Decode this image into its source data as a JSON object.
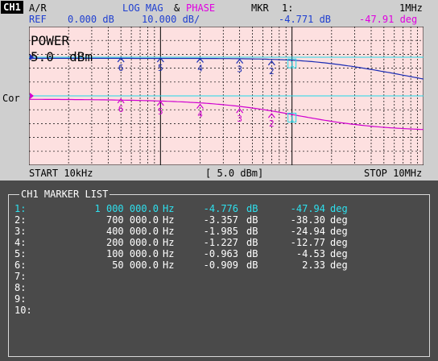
{
  "header": {
    "channel": "CH1",
    "meas": "A/R",
    "format_mag": "LOG MAG",
    "amp": "&",
    "format_phase": "PHASE",
    "mkr": "MKR",
    "mkr_num": "1:",
    "mkr_freq": "1MHz",
    "ref_label": "REF",
    "ref_value": "0.000 dB",
    "scale": "10.000 dB/",
    "mkr_mag": "-4.771 dB",
    "mkr_phase": "-47.91 deg"
  },
  "plot": {
    "power_label": "POWER",
    "power_value": "5.0  dBm",
    "side_label": "Cor",
    "start": "START 10kHz",
    "center": "[ 5.0 dBm]",
    "stop": "STOP 10MHz",
    "active_marker": "1",
    "colors": {
      "mag": "#1a2cb4",
      "phase": "#d000d0",
      "ref": "#20d8e8",
      "background": "#fde0e0"
    },
    "markers": [
      {
        "id": "1",
        "freq_hz": 1000000,
        "mag_db": -4.776,
        "phase_deg": -47.94
      },
      {
        "id": "2",
        "freq_hz": 700000,
        "mag_db": -3.357,
        "phase_deg": -38.3
      },
      {
        "id": "3",
        "freq_hz": 400000,
        "mag_db": -1.985,
        "phase_deg": -24.94
      },
      {
        "id": "4",
        "freq_hz": 200000,
        "mag_db": -1.227,
        "phase_deg": -12.77
      },
      {
        "id": "5",
        "freq_hz": 100000,
        "mag_db": -0.963,
        "phase_deg": -4.53
      },
      {
        "id": "6",
        "freq_hz": 50000,
        "mag_db": -0.909,
        "phase_deg": 2.33
      }
    ]
  },
  "marker_list": {
    "title": "CH1 MARKER LIST",
    "rows": [
      {
        "n": "1:",
        "freq": "1 000 000.0",
        "hz": "Hz",
        "db": "-4.776",
        "dbu": "dB",
        "ph": "-47.94",
        "phu": "deg"
      },
      {
        "n": "2:",
        "freq": "700 000.0",
        "hz": "Hz",
        "db": "-3.357",
        "dbu": "dB",
        "ph": "-38.30",
        "phu": "deg"
      },
      {
        "n": "3:",
        "freq": "400 000.0",
        "hz": "Hz",
        "db": "-1.985",
        "dbu": "dB",
        "ph": "-24.94",
        "phu": "deg"
      },
      {
        "n": "4:",
        "freq": "200 000.0",
        "hz": "Hz",
        "db": "-1.227",
        "dbu": "dB",
        "ph": "-12.77",
        "phu": "deg"
      },
      {
        "n": "5:",
        "freq": "100 000.0",
        "hz": "Hz",
        "db": "-0.963",
        "dbu": "dB",
        "ph": "-4.53",
        "phu": "deg"
      },
      {
        "n": "6:",
        "freq": "50 000.0",
        "hz": "Hz",
        "db": "-0.909",
        "dbu": "dB",
        "ph": "2.33",
        "phu": "deg"
      },
      {
        "n": "7:",
        "freq": "",
        "hz": "",
        "db": "",
        "dbu": "",
        "ph": "",
        "phu": ""
      },
      {
        "n": "8:",
        "freq": "",
        "hz": "",
        "db": "",
        "dbu": "",
        "ph": "",
        "phu": ""
      },
      {
        "n": "9:",
        "freq": "",
        "hz": "",
        "db": "",
        "dbu": "",
        "ph": "",
        "phu": ""
      },
      {
        "n": "10:",
        "freq": "",
        "hz": "",
        "db": "",
        "dbu": "",
        "ph": "",
        "phu": ""
      }
    ]
  }
}
